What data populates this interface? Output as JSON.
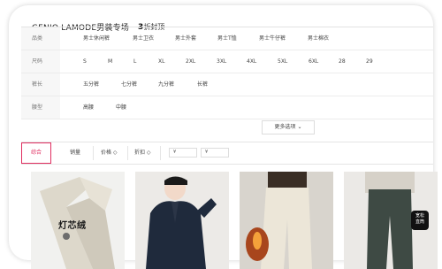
{
  "header": {
    "brand_title": "GENIO LAMODE男装专场",
    "discount_number": "3",
    "discount_suffix": "折封顶"
  },
  "filters": [
    {
      "label": "品类",
      "options": [
        "男士休闲裤",
        "男士卫衣",
        "男士外套",
        "男士T恤",
        "男士牛仔裤",
        "男士棉衣"
      ]
    },
    {
      "label": "尺码",
      "options": [
        "S",
        "M",
        "L",
        "XL",
        "2XL",
        "3XL",
        "4XL",
        "5XL",
        "6XL",
        "28",
        "29"
      ]
    },
    {
      "label": "裤长",
      "options": [
        "五分裤",
        "七分裤",
        "九分裤",
        "长裤"
      ]
    },
    {
      "label": "腰型",
      "options": [
        "高腰",
        "中腰"
      ]
    }
  ],
  "more_options": "更多选项 ⌄",
  "sort": {
    "active": "综合",
    "sales": "销量",
    "price": "价格 ◇",
    "discount": "折扣 ◇",
    "price_min_placeholder": "¥",
    "price_max_placeholder": "¥",
    "price_dash": "-"
  },
  "products": [
    {
      "image": "pants-beige-product",
      "caption": "灯芯绒"
    },
    {
      "image": "model-navy-jacket"
    },
    {
      "image": "model-beige-pants"
    },
    {
      "image": "model-denim-jeans",
      "badge_line1": "宽松",
      "badge_line2": "直筒"
    }
  ]
}
